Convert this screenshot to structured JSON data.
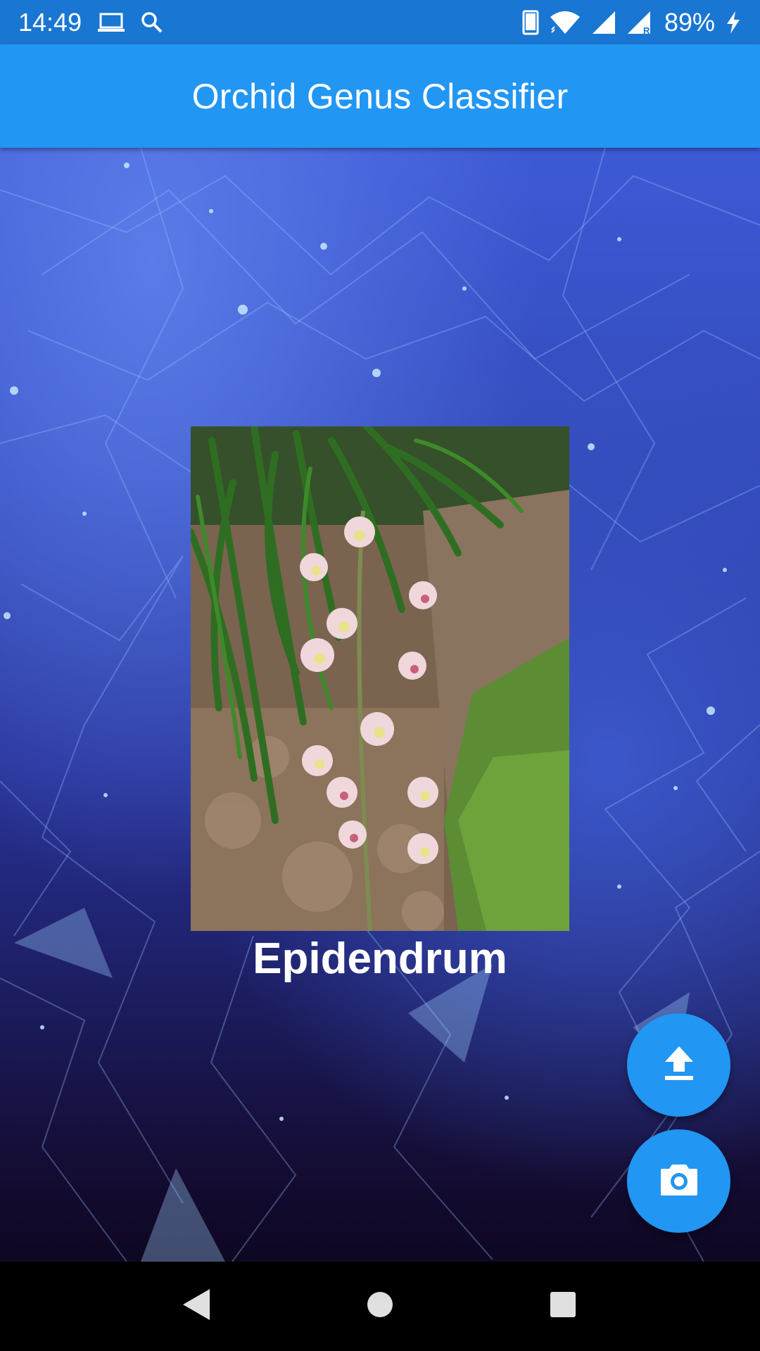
{
  "status_bar": {
    "time": "14:49",
    "battery": "89%",
    "icons": [
      "laptop-icon",
      "search-icon",
      "phone-icon",
      "wifi-icon",
      "signal-icon",
      "roaming-signal-icon",
      "charging-icon"
    ]
  },
  "app_bar": {
    "title": "Orchid Genus Classifier"
  },
  "main": {
    "image_subject": "orchid photo",
    "result_label": "Epidendrum"
  },
  "fabs": {
    "upload_icon": "upload-icon",
    "camera_icon": "camera-icon"
  },
  "nav_bar": {
    "icons": [
      "back-icon",
      "home-icon",
      "recents-icon"
    ]
  },
  "colors": {
    "status_bar": "#1976d2",
    "app_bar": "#2196f3",
    "fab": "#2196f3",
    "nav_bar": "#000000"
  }
}
